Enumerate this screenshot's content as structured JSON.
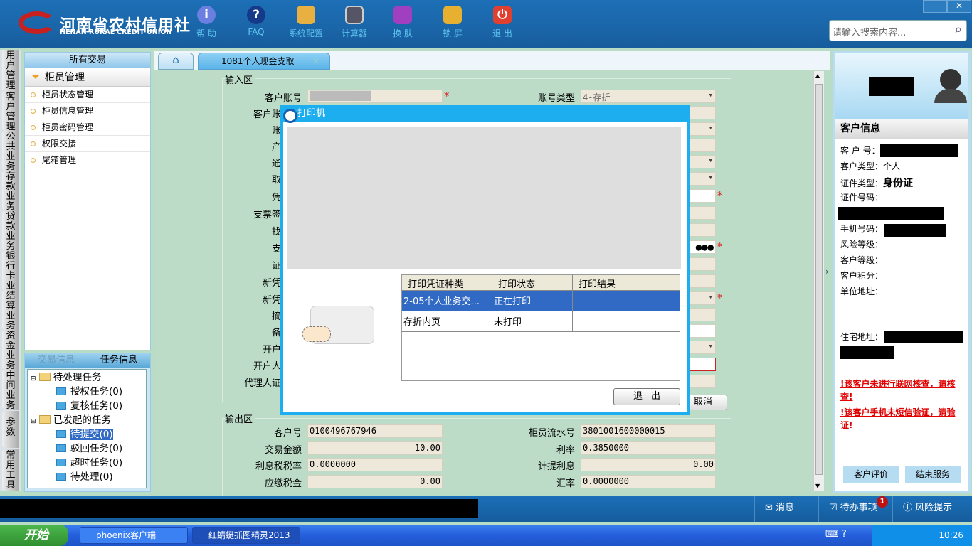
{
  "header": {
    "logo_cn": "河南省农村信用社",
    "logo_en": "HENAN RURAL CREDIT UNION",
    "toolbar": [
      {
        "icon": "info-icon",
        "label": "帮 助"
      },
      {
        "icon": "question-icon",
        "label": "FAQ"
      },
      {
        "icon": "toolbox-icon",
        "label": "系统配置"
      },
      {
        "icon": "calculator-icon",
        "label": "计算器"
      },
      {
        "icon": "shirt-icon",
        "label": "换 肤"
      },
      {
        "icon": "lock-icon",
        "label": "锁 屏"
      },
      {
        "icon": "power-icon",
        "label": "退 出"
      }
    ],
    "search_placeholder": "请输入搜索内容...",
    "window_buttons": [
      "—",
      "✕"
    ]
  },
  "vtabs": [
    "用户管理",
    "客户管理",
    "公共业务",
    "存款业务",
    "贷款业务",
    "银行卡业务",
    "结算业务",
    "资金业务",
    "中间业务",
    "参数",
    "常用工具"
  ],
  "left": {
    "title": "所有交易",
    "group": "柜员管理",
    "items": [
      "柜员状态管理",
      "柜员信息管理",
      "柜员密码管理",
      "权限交接",
      "尾箱管理"
    ]
  },
  "tasks": {
    "tabs": [
      "交易信息",
      "任务信息"
    ],
    "tree": [
      {
        "label": "待处理任务",
        "children": [
          "授权任务(0)",
          "复核任务(0)"
        ]
      },
      {
        "label": "已发起的任务",
        "children": [
          "待提交(0)",
          "驳回任务(0)",
          "超时任务(0)",
          "待处理(0)"
        ]
      }
    ]
  },
  "tabs": {
    "active": "1081个人现金支取",
    "close": "×"
  },
  "input_area": {
    "legend": "输入区",
    "left_labels": [
      "客户账号",
      "客户账户",
      "账户",
      "产品",
      "通知",
      "取现",
      "凭证",
      "支票签发",
      "找零",
      "支付",
      "证件",
      "新凭证",
      "新凭证",
      "摘要",
      "备注",
      "开户人",
      "开户人证",
      "代理人证件"
    ],
    "account_type_label": "账号类型",
    "account_type_value": "4-存折",
    "product_partial": "5",
    "password_mask": "●●●",
    "cancel_partial": "取消",
    "required_mark": "*"
  },
  "output_area": {
    "legend": "输出区",
    "fields": [
      {
        "label": "客户号",
        "value": "0100496767946"
      },
      {
        "label": "柜员流水号",
        "value": "3801001600000015"
      },
      {
        "label": "交易金额",
        "value": "10.00"
      },
      {
        "label": "利率",
        "value": "0.3850000"
      },
      {
        "label": "利息税税率",
        "value": "0.0000000"
      },
      {
        "label": "计提利息",
        "value": "0.00"
      },
      {
        "label": "应缴税金",
        "value": "0.00"
      },
      {
        "label": "汇率",
        "value": "0.0000000"
      }
    ]
  },
  "modal": {
    "title": "打印机",
    "columns": [
      "打印凭证种类",
      "打印状态",
      "打印结果"
    ],
    "rows": [
      {
        "type": "2-05个人业务交...",
        "status": "正在打印",
        "result": ""
      },
      {
        "type": "存折内页",
        "status": "未打印",
        "result": ""
      }
    ],
    "exit": "退出"
  },
  "customer": {
    "title": "客户信息",
    "fields": [
      {
        "label": "客 户 号：",
        "value": ""
      },
      {
        "label": "客户类型：",
        "value": "个人"
      },
      {
        "label": "证件类型：",
        "value": "身份证"
      },
      {
        "label": "证件号码：",
        "value": ""
      },
      {
        "label": "手机号码：",
        "value": ""
      },
      {
        "label": "风险等级：",
        "value": ""
      },
      {
        "label": "客户等级：",
        "value": ""
      },
      {
        "label": "客户积分：",
        "value": ""
      },
      {
        "label": "单位地址：",
        "value": ""
      },
      {
        "label": "住宅地址：",
        "value": ""
      }
    ],
    "warnings": [
      "!该客户未进行联网核查，请核查!",
      "!该客户手机未短信验证，请验证!"
    ],
    "buttons": [
      "客户评价",
      "结束服务"
    ]
  },
  "statusbar": {
    "message": "消息",
    "todo": "待办事项",
    "todo_badge": "1",
    "risk": "风险提示"
  },
  "taskbar": {
    "start": "开始",
    "tasks": [
      "phoenix客户端",
      "红蜻蜓抓图精灵2013"
    ],
    "clock": "10:26"
  },
  "colors": {
    "header": "#1a65a8",
    "accent": "#1daeef",
    "selection": "#316ac5",
    "warning": "#e00000"
  }
}
